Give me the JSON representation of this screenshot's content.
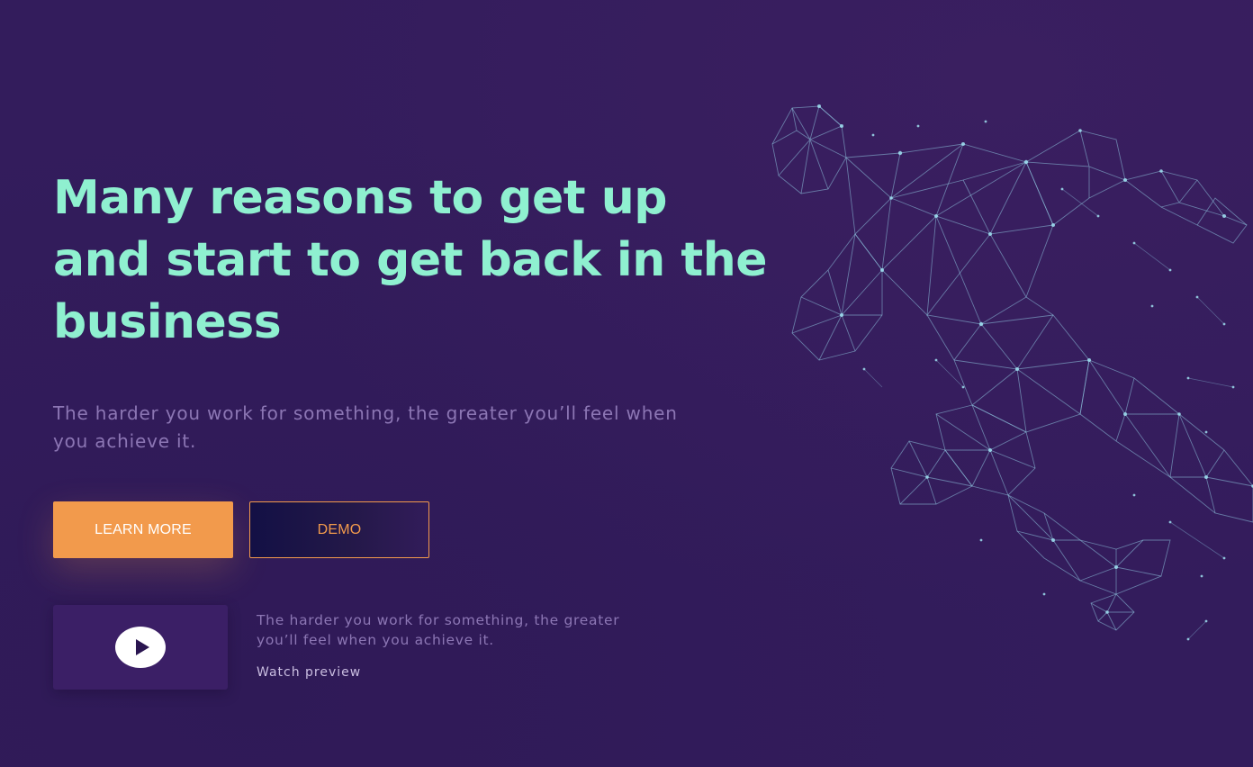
{
  "hero": {
    "title": "Many reasons to get up and start to get back in the business",
    "subtitle": "The harder you work for something, the greater you’ll feel when you achieve it."
  },
  "buttons": {
    "learn_more": "LEARN MORE",
    "demo": "DEMO"
  },
  "preview": {
    "text": "The harder you work for something, the greater you’ll feel when you achieve it.",
    "link": "Watch preview"
  },
  "colors": {
    "background": "#331c5c",
    "title": "#8ff0d0",
    "muted_text": "#8c76b4",
    "accent": "#f29a4c",
    "mesh": "#8fc6e0"
  },
  "icons": {
    "play": "play-icon"
  }
}
